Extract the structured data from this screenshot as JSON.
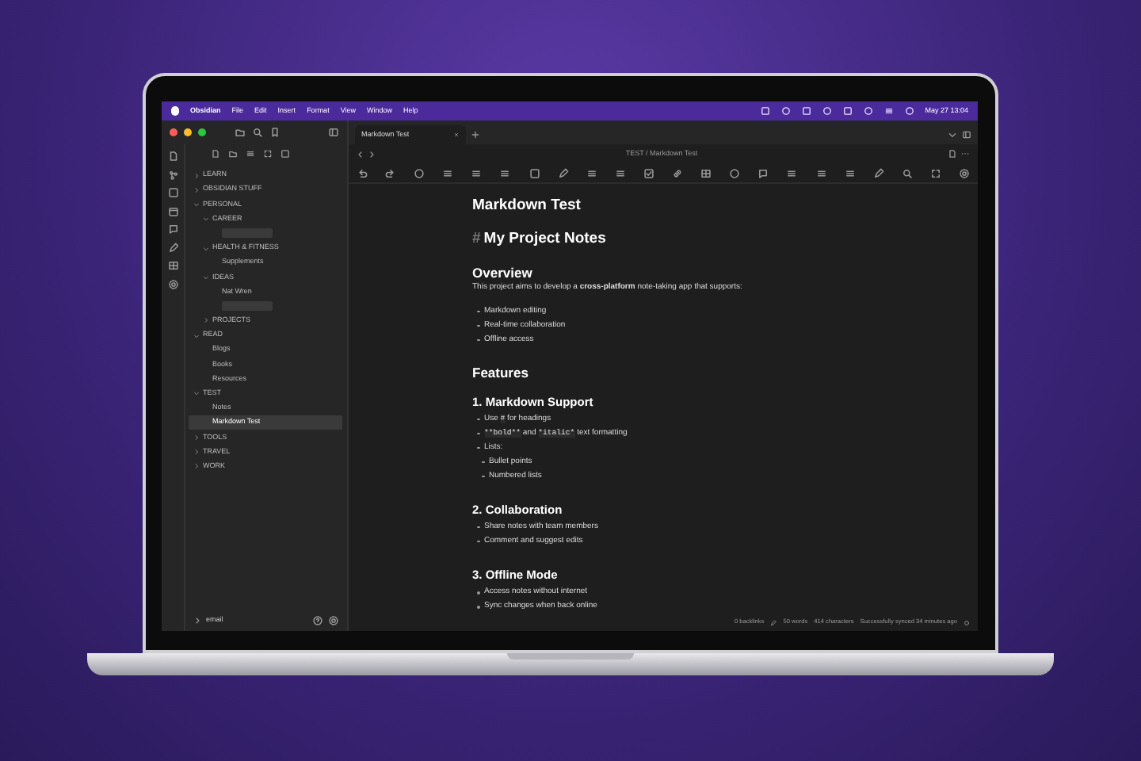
{
  "menubar": {
    "app": "Obsidian",
    "menus": [
      "File",
      "Edit",
      "Insert",
      "Format",
      "View",
      "Window",
      "Help"
    ],
    "clock": "May 27 13:04"
  },
  "tabs": [
    {
      "label": "Markdown Test",
      "selected": true
    }
  ],
  "breadcrumb": "TEST / Markdown Test",
  "tree": [
    {
      "kind": "folder",
      "label": "LEARN",
      "expanded": false
    },
    {
      "kind": "folder",
      "label": "OBSIDIAN STUFF",
      "expanded": false
    },
    {
      "kind": "folder",
      "label": "PERSONAL",
      "expanded": true,
      "children": [
        {
          "kind": "folder",
          "label": "CAREER",
          "expanded": true,
          "children": [
            {
              "kind": "redacted"
            }
          ]
        },
        {
          "kind": "folder",
          "label": "HEALTH & FITNESS",
          "expanded": true,
          "children": [
            {
              "kind": "file",
              "label": "Supplements",
              "selected": false
            }
          ]
        },
        {
          "kind": "folder",
          "label": "IDEAS",
          "expanded": true,
          "children": [
            {
              "kind": "file",
              "label": "Nat Wren",
              "selected": false
            },
            {
              "kind": "redacted"
            }
          ]
        },
        {
          "kind": "folder",
          "label": "PROJECTS",
          "expanded": false
        }
      ]
    },
    {
      "kind": "folder",
      "label": "READ",
      "expanded": true,
      "children": [
        {
          "kind": "file",
          "label": "Blogs",
          "selected": false
        },
        {
          "kind": "file",
          "label": "Books",
          "selected": false
        },
        {
          "kind": "file",
          "label": "Resources",
          "selected": false
        }
      ]
    },
    {
      "kind": "folder",
      "label": "TEST",
      "expanded": true,
      "children": [
        {
          "kind": "file",
          "label": "Notes",
          "selected": false
        },
        {
          "kind": "file",
          "label": "Markdown Test",
          "selected": true
        }
      ]
    },
    {
      "kind": "folder",
      "label": "TOOLS",
      "expanded": false
    },
    {
      "kind": "folder",
      "label": "TRAVEL",
      "expanded": false
    },
    {
      "kind": "folder",
      "label": "WORK",
      "expanded": false
    }
  ],
  "vault": "email",
  "note": [
    {
      "kind": "title",
      "text": "Markdown Test"
    },
    {
      "kind": "h1",
      "marker": "#",
      "text": "My Project Notes"
    },
    {
      "kind": "h2",
      "text": "Overview"
    },
    {
      "kind": "p",
      "text": "This project aims to develop a **cross-platform** note-taking app that supports:"
    },
    {
      "kind": "list",
      "items": [
        {
          "parts": [
            {
              "kind": "text",
              "text": "Markdown editing"
            }
          ]
        },
        {
          "parts": [
            {
              "kind": "text",
              "text": "Real-time collaboration"
            }
          ]
        },
        {
          "parts": [
            {
              "kind": "text",
              "text": "Offline access"
            }
          ]
        }
      ]
    },
    {
      "kind": "h2",
      "text": "Features"
    },
    {
      "kind": "h3",
      "text": "1. Markdown Support"
    },
    {
      "kind": "list",
      "items": [
        {
          "parts": [
            {
              "kind": "text",
              "text": "Use "
            },
            {
              "kind": "code",
              "text": "#"
            },
            {
              "kind": "text",
              "text": " for headings"
            }
          ]
        },
        {
          "parts": [
            {
              "kind": "code",
              "text": "**bold**"
            },
            {
              "kind": "text",
              "text": " and "
            },
            {
              "kind": "code",
              "text": "*italic*"
            },
            {
              "kind": "text",
              "text": " text formatting"
            }
          ]
        },
        {
          "parts": [
            {
              "kind": "text",
              "text": "Lists:"
            }
          ],
          "children": [
            {
              "parts": [
                {
                  "kind": "text",
                  "text": "Bullet points"
                }
              ]
            },
            {
              "parts": [
                {
                  "kind": "text",
                  "text": "Numbered lists"
                }
              ]
            }
          ]
        }
      ]
    },
    {
      "kind": "h3",
      "text": "2. Collaboration"
    },
    {
      "kind": "list",
      "items": [
        {
          "parts": [
            {
              "kind": "text",
              "text": "Share notes with team members"
            }
          ]
        },
        {
          "parts": [
            {
              "kind": "text",
              "text": "Comment and suggest edits"
            }
          ]
        }
      ]
    },
    {
      "kind": "h3",
      "text": "3. Offline Mode"
    },
    {
      "kind": "list",
      "items": [
        {
          "parts": [
            {
              "kind": "text",
              "text": "Access notes without internet"
            }
          ]
        },
        {
          "parts": [
            {
              "kind": "text",
              "text": "Sync changes when back online"
            }
          ]
        }
      ]
    }
  ],
  "status_bar": [
    "0 backlinks",
    "50 words",
    "414 characters",
    "Successfully synced 34 minutes ago"
  ]
}
